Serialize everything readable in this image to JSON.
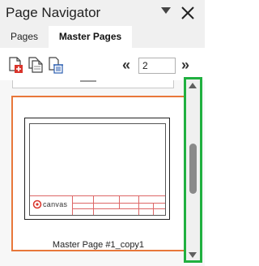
{
  "panel": {
    "title": "Page Navigator"
  },
  "tabs": [
    {
      "label": "Pages",
      "active": false
    },
    {
      "label": "Master Pages",
      "active": true
    }
  ],
  "toolbar": {
    "icons": [
      "new-master-page-icon",
      "duplicate-page-icon",
      "delete-page-icon"
    ],
    "prev_symbol": "«",
    "next_symbol": "»",
    "page_value": "2"
  },
  "thumbnail": {
    "label": "Master Page #1_copy1",
    "logo_text": "canvas",
    "selected_border_color": "#e8773a"
  },
  "scrollbar": {
    "highlight_color": "#20b040"
  }
}
